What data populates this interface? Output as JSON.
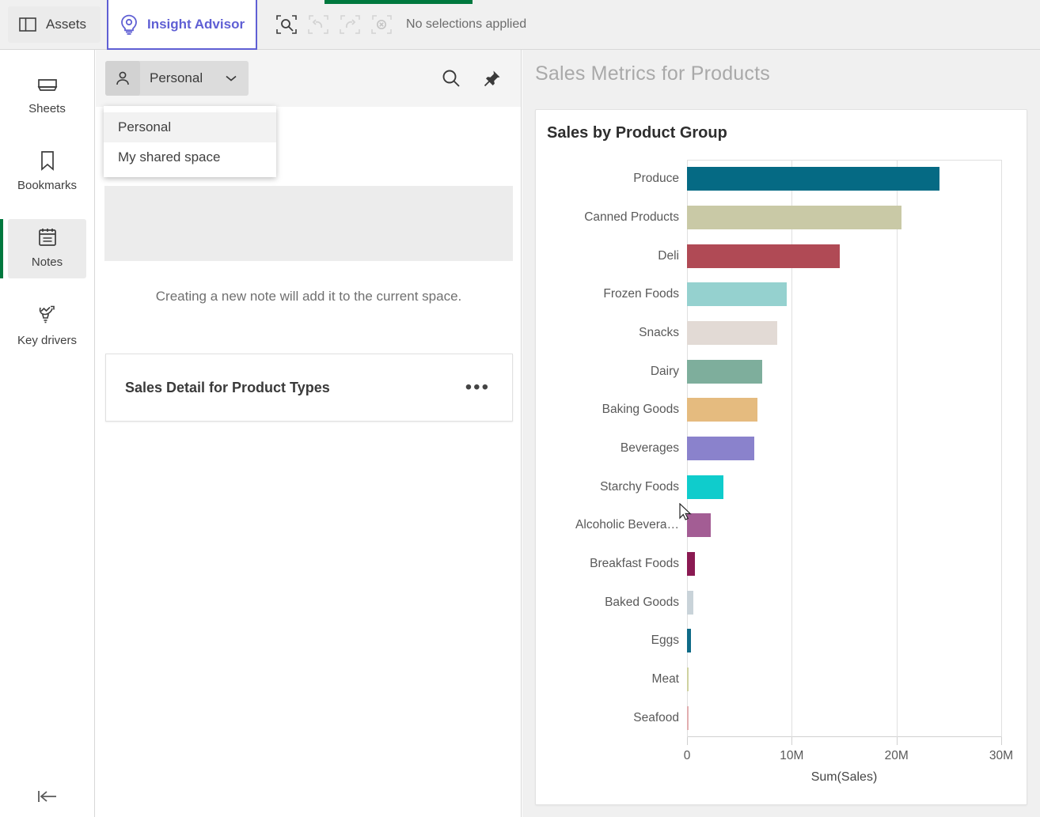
{
  "topbar": {
    "assets_label": "Assets",
    "insight_advisor_label": "Insight Advisor",
    "selection_status": "No selections applied",
    "tools": [
      {
        "name": "selections-tool-icon",
        "title": "Selections tool"
      },
      {
        "name": "undo-icon",
        "title": "Step back"
      },
      {
        "name": "redo-icon",
        "title": "Step forward"
      },
      {
        "name": "clear-selections-icon",
        "title": "Clear all selections"
      }
    ],
    "accent_color": "#5f5fd4",
    "green_color": "#00783e"
  },
  "sidebar": {
    "items": [
      {
        "label": "Sheets",
        "icon": "sheets-icon",
        "active": false
      },
      {
        "label": "Bookmarks",
        "icon": "bookmark-icon",
        "active": false
      },
      {
        "label": "Notes",
        "icon": "notes-icon",
        "active": true
      },
      {
        "label": "Key drivers",
        "icon": "key-drivers-icon",
        "active": false
      }
    ],
    "collapse_icon": "collapse-left-icon"
  },
  "notes": {
    "space_selector": {
      "value": "Personal",
      "icon": "person-icon",
      "chevron": "chevron-down-icon"
    },
    "dropdown": {
      "open": true,
      "options": [
        {
          "label": "Personal",
          "highlighted": true
        },
        {
          "label": "My shared space",
          "highlighted": false
        }
      ]
    },
    "actions": [
      {
        "name": "search-icon",
        "title": "Search notes"
      },
      {
        "name": "pin-icon",
        "title": "Pin"
      }
    ],
    "empty_message": "Creating a new note will add it to the current space.",
    "note_cards": [
      {
        "title": "Sales Detail for Product Types",
        "menu": "•••"
      }
    ]
  },
  "right_pane": {
    "title": "Sales Metrics for Products"
  },
  "chart_data": {
    "type": "bar",
    "orientation": "horizontal",
    "title": "Sales by Product Group",
    "xlabel": "Sum(Sales)",
    "ylabel": "",
    "xlim": [
      0,
      30000000
    ],
    "xticks": [
      0,
      10000000,
      20000000,
      30000000
    ],
    "xtick_labels": [
      "0",
      "10M",
      "20M",
      "30M"
    ],
    "grid": true,
    "legend": false,
    "categories": [
      "Produce",
      "Canned Products",
      "Deli",
      "Frozen Foods",
      "Snacks",
      "Dairy",
      "Baking Goods",
      "Beverages",
      "Starchy Foods",
      "Alcoholic Bevera…",
      "Breakfast Foods",
      "Baked Goods",
      "Eggs",
      "Meat",
      "Seafood"
    ],
    "values": [
      24100000,
      20500000,
      14600000,
      9500000,
      8600000,
      7200000,
      6700000,
      6400000,
      3450000,
      2300000,
      750000,
      600000,
      400000,
      180000,
      120000
    ],
    "colors": [
      "#056a84",
      "#c9c9a6",
      "#b04a55",
      "#95d1cf",
      "#e2dad5",
      "#7eae9c",
      "#e5bb7f",
      "#8a82cc",
      "#0fcccc",
      "#a35d94",
      "#8a1a52",
      "#c9d3d9",
      "#0f6b87",
      "#cfd2a0",
      "#e2aeb0"
    ]
  }
}
